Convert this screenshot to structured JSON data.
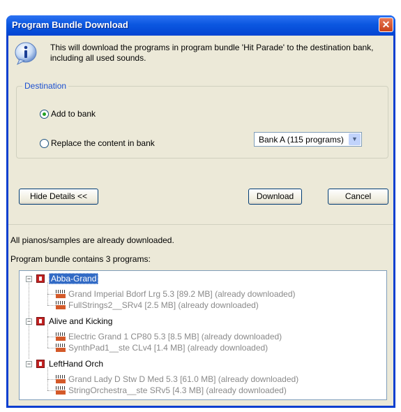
{
  "window": {
    "title": "Program Bundle Download",
    "close_glyph": "✕"
  },
  "message": "This will download the programs in program bundle 'Hit Parade' to the destination bank, including all used sounds.",
  "destination": {
    "legend": "Destination",
    "add_label": "Add to bank",
    "replace_label": "Replace the content in bank",
    "selected": "add",
    "bank_select_value": "Bank A (115 programs)"
  },
  "buttons": {
    "hide_details": "Hide Details <<",
    "download": "Download",
    "cancel": "Cancel"
  },
  "status": {
    "samples": "All pianos/samples are already downloaded.",
    "contains": "Program bundle contains 3 programs:"
  },
  "tree": [
    {
      "name": "Abba-Grand",
      "selected": true,
      "children": [
        "Grand Imperial Bdorf Lrg 5.3 [89.2 MB] (already downloaded)",
        "FullStrings2__SRv4 [2.5 MB] (already downloaded)"
      ]
    },
    {
      "name": "Alive and Kicking",
      "children": [
        "Electric Grand 1 CP80  5.3 [8.5 MB] (already downloaded)",
        "SynthPad1__ste CLv4 [1.4 MB] (already downloaded)"
      ]
    },
    {
      "name": "LeftHand Orch",
      "children": [
        "Grand Lady D  Stw D  Med 5.3 [61.0 MB] (already downloaded)",
        "StringOrchestra__ste SRv5 [4.3 MB] (already downloaded)"
      ]
    }
  ],
  "icons": {
    "info": "info-icon",
    "bank": "bank-icon",
    "program": "program-icon",
    "collapse": "collapse-icon"
  }
}
